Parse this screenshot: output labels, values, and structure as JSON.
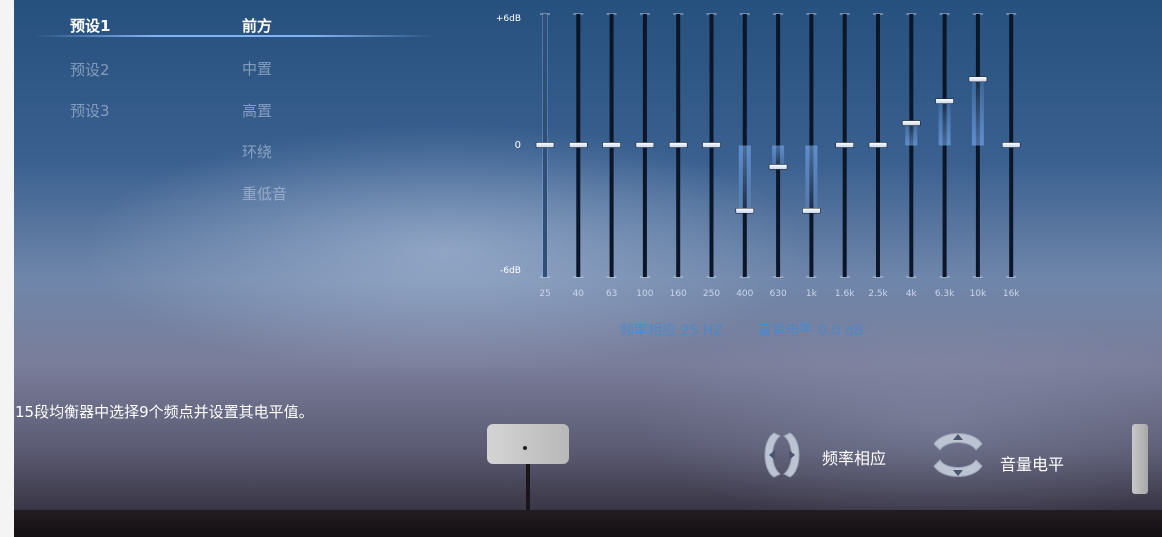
{
  "presets": [
    "预设1",
    "预设2",
    "预设3"
  ],
  "active_preset_index": 0,
  "channels": [
    "前方",
    "中置",
    "高置",
    "环绕",
    "重低音"
  ],
  "active_channel_index": 0,
  "eq": {
    "scale_labels": {
      "top": "+6dB",
      "middle": "0",
      "bottom": "-6dB"
    },
    "range_db": [
      -6,
      6
    ],
    "bands": [
      {
        "freq": "25",
        "level_db": 0
      },
      {
        "freq": "40",
        "level_db": 0
      },
      {
        "freq": "63",
        "level_db": 0
      },
      {
        "freq": "100",
        "level_db": 0
      },
      {
        "freq": "160",
        "level_db": 0
      },
      {
        "freq": "250",
        "level_db": 0
      },
      {
        "freq": "400",
        "level_db": -3
      },
      {
        "freq": "630",
        "level_db": -1
      },
      {
        "freq": "1k",
        "level_db": -3
      },
      {
        "freq": "1.6k",
        "level_db": 0
      },
      {
        "freq": "2.5k",
        "level_db": 0
      },
      {
        "freq": "4k",
        "level_db": 1
      },
      {
        "freq": "6.3k",
        "level_db": 2
      },
      {
        "freq": "10k",
        "level_db": 3
      },
      {
        "freq": "16k",
        "level_db": 0
      }
    ],
    "selected_band_index": 0
  },
  "status": {
    "freq_label": "频率相应",
    "freq_value": "25",
    "freq_unit": "HZ",
    "level_label": "音量电平",
    "level_value": "0.0",
    "level_unit": "dB"
  },
  "instruction": "从15段均衡器中选择9个频点并设置其电平值。",
  "hints": {
    "frequency": "频率相应",
    "level": "音量电平"
  },
  "colors": {
    "accent": "#3a8ad8",
    "track": "#0b1628",
    "highlight": "#7fb6ff"
  },
  "icons": {
    "frequency": "left-right-arrows-icon",
    "level": "up-down-arrows-icon"
  }
}
